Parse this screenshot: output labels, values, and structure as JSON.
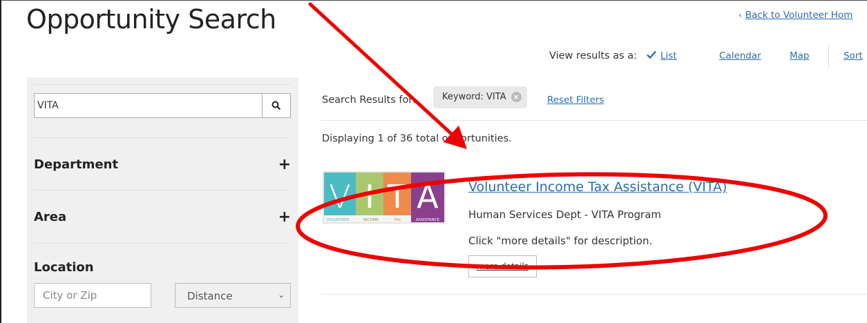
{
  "page": {
    "title": "Opportunity Search",
    "back_link": "Back to Volunteer Hom"
  },
  "view_bar": {
    "label": "View results as a:",
    "list": "List",
    "calendar": "Calendar",
    "map": "Map",
    "sort": "Sort"
  },
  "sidebar": {
    "search_value": "VITA",
    "facets": [
      "Department",
      "Area",
      "Location"
    ],
    "city_placeholder": "City or Zip",
    "distance_selected": "Distance"
  },
  "results": {
    "results_for_label": "Search Results for:",
    "chip_label": "Keyword: VITA",
    "reset_label": "Reset Filters",
    "displaying": "Displaying 1 of 36 total opportunities."
  },
  "opportunity": {
    "title": "Volunteer Income Tax Assistance (VITA)",
    "dept": "Human Services Dept - VITA Program",
    "description": "Click \"more details\" for description.",
    "more_label": "more details",
    "logo": {
      "letters": [
        "V",
        "I",
        "T",
        "A"
      ],
      "words": [
        "VOLUNTEER",
        "INCOME",
        "TAX",
        "ASSISTANCE"
      ]
    }
  },
  "colors": {
    "link": "#2b6cb0",
    "sidebar_bg": "#f0f0f0",
    "annotation": "#ee0000",
    "vita_teal": "#4bbcc4",
    "vita_green": "#a9c76d",
    "vita_orange": "#ee8a4c",
    "vita_purple": "#8a3f8d"
  }
}
